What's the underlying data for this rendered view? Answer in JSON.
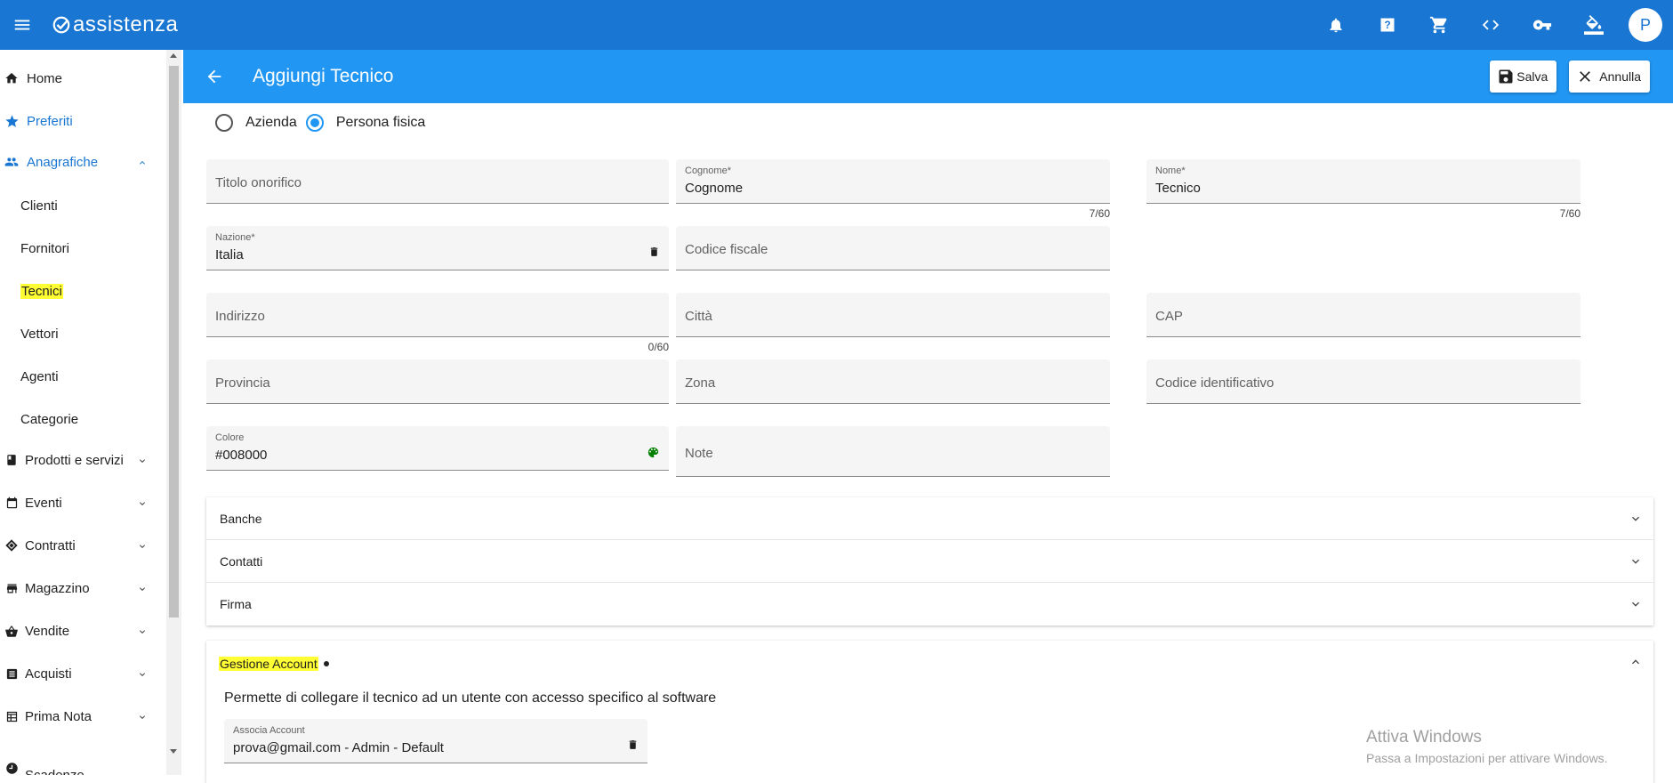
{
  "app": {
    "logo_text": "assistenza",
    "avatar_letter": "P"
  },
  "topbar_icons": [
    "bell-icon",
    "help-icon",
    "cart-icon",
    "code-icon",
    "key-icon",
    "paint-bucket-icon"
  ],
  "sidebar": {
    "items": [
      {
        "label": "Home",
        "icon": "home-icon"
      },
      {
        "label": "Preferiti",
        "icon": "star-icon"
      },
      {
        "label": "Anagrafiche",
        "icon": "people-icon"
      },
      {
        "label": "Clienti"
      },
      {
        "label": "Fornitori"
      },
      {
        "label": "Tecnici"
      },
      {
        "label": "Vettori"
      },
      {
        "label": "Agenti"
      },
      {
        "label": "Categorie"
      },
      {
        "label": "Prodotti e servizi",
        "icon": "book-icon"
      },
      {
        "label": "Eventi",
        "icon": "calendar-icon"
      },
      {
        "label": "Contratti",
        "icon": "handshake-icon"
      },
      {
        "label": "Magazzino",
        "icon": "store-icon"
      },
      {
        "label": "Vendite",
        "icon": "basket-icon"
      },
      {
        "label": "Acquisti",
        "icon": "list-icon"
      },
      {
        "label": "Prima Nota",
        "icon": "table-icon"
      },
      {
        "label": "Scadenze",
        "icon": "clock-icon"
      }
    ]
  },
  "header": {
    "title": "Aggiungi Tecnico",
    "save_label": "Salva",
    "cancel_label": "Annulla"
  },
  "form": {
    "radio_azienda": "Azienda",
    "radio_persona": "Persona fisica",
    "titolo_onorifico": {
      "placeholder": "Titolo onorifico"
    },
    "cognome": {
      "label": "Cognome*",
      "value": "Cognome",
      "counter": "7/60"
    },
    "nome": {
      "label": "Nome*",
      "value": "Tecnico",
      "counter": "7/60"
    },
    "nazione": {
      "label": "Nazione*",
      "value": "Italia"
    },
    "codice_fiscale": {
      "placeholder": "Codice fiscale"
    },
    "indirizzo": {
      "placeholder": "Indirizzo",
      "counter": "0/60"
    },
    "citta": {
      "placeholder": "Città"
    },
    "cap": {
      "placeholder": "CAP"
    },
    "provincia": {
      "placeholder": "Provincia"
    },
    "zona": {
      "placeholder": "Zona"
    },
    "codice_identificativo": {
      "placeholder": "Codice identificativo"
    },
    "colore": {
      "label": "Colore",
      "value": "#008000"
    },
    "note": {
      "placeholder": "Note"
    }
  },
  "panels": {
    "banche": "Banche",
    "contatti": "Contatti",
    "firma": "Firma"
  },
  "gestione_account": {
    "title": "Gestione Account",
    "description": "Permette di collegare il tecnico ad un utente con accesso specifico al software",
    "associa_label": "Associa Account",
    "associa_value": "prova@gmail.com - Admin - Default"
  },
  "watermark": {
    "line1": "Attiva Windows",
    "line2": "Passa a Impostazioni per attivare Windows."
  },
  "colors": {
    "topbar": "#1976d2",
    "header": "#2196f3",
    "highlight": "#ffff33",
    "palette_icon": "#008000"
  }
}
